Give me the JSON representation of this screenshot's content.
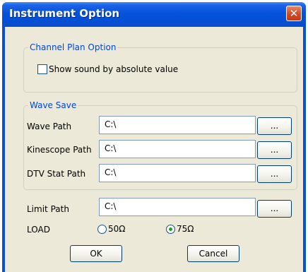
{
  "window": {
    "title": "Instrument Option",
    "close_glyph": "✕"
  },
  "channel_plan": {
    "legend": "Channel Plan Option",
    "show_sound_label": "Show sound by absolute value",
    "show_sound_checked": false
  },
  "wave_save": {
    "legend": "Wave Save",
    "rows": [
      {
        "label": "Wave Path",
        "value": "C:\\",
        "browse": "..."
      },
      {
        "label": "Kinescope Path",
        "value": "C:\\",
        "browse": "..."
      },
      {
        "label": "DTV Stat Path",
        "value": "C:\\",
        "browse": "..."
      }
    ]
  },
  "limit": {
    "label": "Limit Path",
    "value": "C:\\",
    "browse": "..."
  },
  "load": {
    "label": "LOAD",
    "options": [
      {
        "label": "50Ω",
        "selected": false
      },
      {
        "label": "75Ω",
        "selected": true
      }
    ]
  },
  "buttons": {
    "ok": "OK",
    "cancel": "Cancel"
  },
  "colors": {
    "title_bar": "#0552dc",
    "dialog_bg": "#ece9d8",
    "legend_text": "#0046d5",
    "close_button": "#d24a24"
  }
}
